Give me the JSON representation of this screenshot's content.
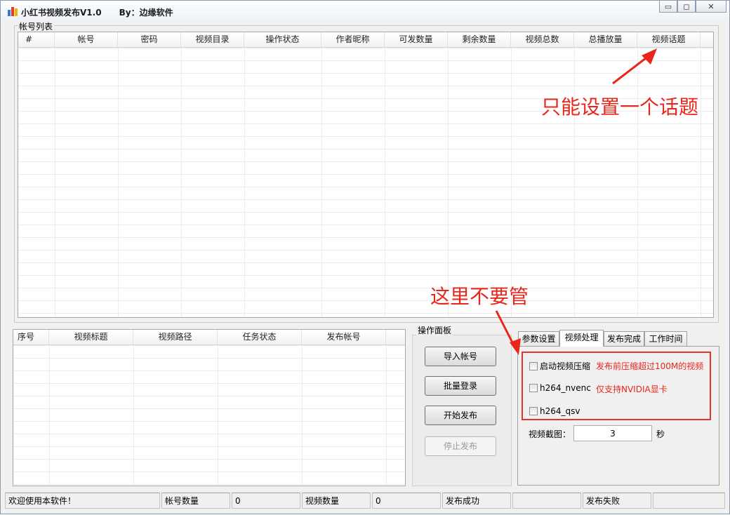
{
  "window": {
    "title": "小红书视频发布V1.0      By：边缘软件",
    "buttons": {
      "minimize": "▭",
      "maximize": "◻",
      "close": "✕"
    }
  },
  "accounts": {
    "group_label": "帐号列表",
    "columns": [
      "#",
      "帐号",
      "密码",
      "视频目录",
      "操作状态",
      "作者昵称",
      "可发数量",
      "剩余数量",
      "视频总数",
      "总播放量",
      "视频话题"
    ]
  },
  "tasks": {
    "columns": [
      "序号",
      "视频标题",
      "视频路径",
      "任务状态",
      "发布帐号"
    ]
  },
  "panel": {
    "label": "操作面板",
    "buttons": {
      "import": "导入帐号",
      "batch_login": "批量登录",
      "start": "开始发布",
      "stop": "停止发布"
    }
  },
  "tabs": [
    "参数设置",
    "视频处理",
    "发布完成",
    "工作时间"
  ],
  "video_processing": {
    "compress_label": "启动视频压缩",
    "compress_note": "发布前压缩超过100M的视频",
    "nvenc_label": "h264_nvenc",
    "nvenc_note": "仅支持NVIDIA显卡",
    "qsv_label": "h264_qsv",
    "screenshot_label": "视频截图：",
    "screenshot_value": "3",
    "screenshot_unit": "秒"
  },
  "statusbar": {
    "welcome": "欢迎使用本软件！",
    "account_count_label": "帐号数量",
    "account_count": "0",
    "video_count_label": "视频数量",
    "video_count": "0",
    "success_label": "发布成功",
    "success_value": "",
    "fail_label": "发布失败",
    "fail_value": ""
  },
  "annotations": {
    "topic_note": "只能设置一个话题",
    "ignore_note": "这里不要管"
  },
  "colors": {
    "annotation": "#e8261c"
  }
}
